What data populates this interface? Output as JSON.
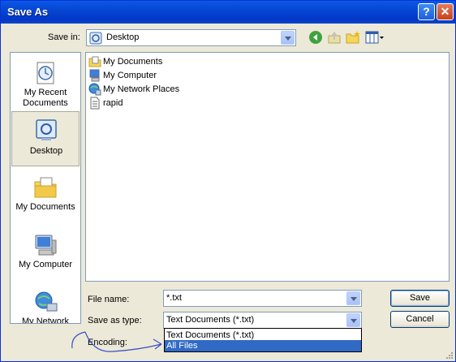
{
  "window": {
    "title": "Save As",
    "help_glyph": "?",
    "close_glyph": "✕"
  },
  "toolbar": {
    "save_in_label": "Save in:",
    "save_in_value": "Desktop",
    "icons": [
      "back-arrow-icon",
      "up-folder-icon",
      "new-folder-icon",
      "view-menu-icon"
    ]
  },
  "places": [
    {
      "label": "My Recent Documents",
      "icon": "recent-documents-icon"
    },
    {
      "label": "Desktop",
      "icon": "desktop-icon",
      "selected": true
    },
    {
      "label": "My Documents",
      "icon": "my-documents-icon"
    },
    {
      "label": "My Computer",
      "icon": "my-computer-icon"
    },
    {
      "label": "My Network",
      "icon": "my-network-icon"
    }
  ],
  "files": [
    {
      "name": "My Documents",
      "icon": "folder-documents-icon"
    },
    {
      "name": "My Computer",
      "icon": "computer-icon"
    },
    {
      "name": "My Network Places",
      "icon": "network-places-icon"
    },
    {
      "name": "rapid",
      "icon": "text-file-icon"
    }
  ],
  "form": {
    "file_name_label": "File name:",
    "file_name_value": "*.txt",
    "save_as_type_label": "Save as type:",
    "save_as_type_value": "Text Documents (*.txt)",
    "encoding_label": "Encoding:",
    "save_button": "Save",
    "cancel_button": "Cancel"
  },
  "dropdown": {
    "options": [
      "Text Documents (*.txt)",
      "All Files"
    ],
    "selected": "All Files"
  },
  "colors": {
    "title_bar": "#0a58e6",
    "selection": "#316ac5",
    "dialog_bg": "#ece9d8",
    "annotation": "#3b4fc8"
  }
}
